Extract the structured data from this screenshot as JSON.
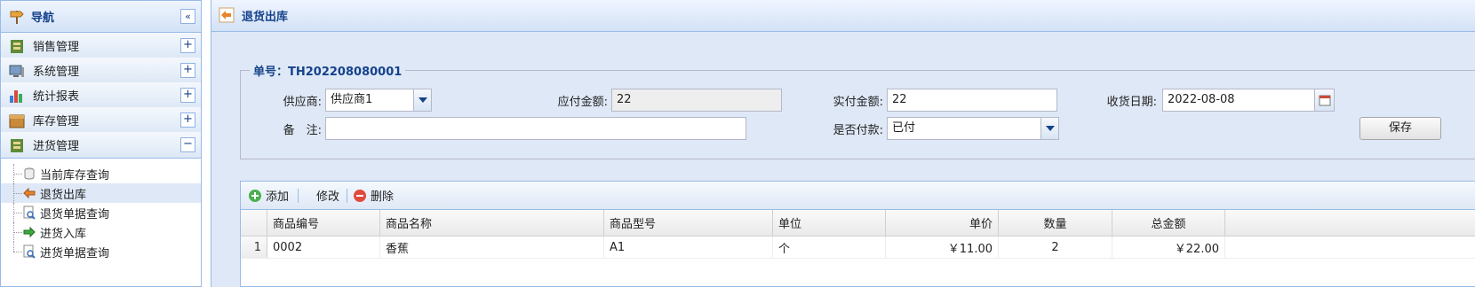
{
  "colors": {
    "accent": "#15428b",
    "panel_border": "#99bbe8",
    "background": "#dfe8f6"
  },
  "nav": {
    "title": "导航",
    "collapse_glyph": "«",
    "sections": [
      {
        "label": "销售管理",
        "icon": "sales-icon",
        "toggle": "+"
      },
      {
        "label": "系统管理",
        "icon": "computer-icon",
        "toggle": "+"
      },
      {
        "label": "统计报表",
        "icon": "bar-chart-icon",
        "toggle": "+"
      },
      {
        "label": "库存管理",
        "icon": "box-icon",
        "toggle": "+"
      },
      {
        "label": "进货管理",
        "icon": "purchase-icon",
        "toggle": "−"
      }
    ],
    "items": [
      {
        "label": "当前库存查询",
        "icon": "database-icon",
        "selected": false
      },
      {
        "label": "退货出库",
        "icon": "return-arrow-icon",
        "selected": true
      },
      {
        "label": "退货单据查询",
        "icon": "search-document-icon",
        "selected": false
      },
      {
        "label": "进货入库",
        "icon": "inbound-arrow-icon",
        "selected": false
      },
      {
        "label": "进货单据查询",
        "icon": "search-document-icon",
        "selected": false
      }
    ]
  },
  "panel": {
    "title": "退货出库",
    "icon": "return-arrow-icon"
  },
  "form": {
    "legend": "单号：TH202208080001",
    "supplier_label": "供应商:",
    "supplier_value": "供应商1",
    "payable_label": "应付金额:",
    "payable_value": "22",
    "paid_label": "实付金额:",
    "paid_value": "22",
    "date_label": "收货日期:",
    "date_value": "2022-08-08",
    "remark_label": "备　注:",
    "remark_value": "",
    "is_paid_label": "是否付款:",
    "is_paid_value": "已付",
    "save_label": "保存"
  },
  "toolbar": {
    "add_label": "添加",
    "edit_label": "修改",
    "delete_label": "删除"
  },
  "grid": {
    "columns": [
      "商品编号",
      "商品名称",
      "商品型号",
      "单位",
      "单价",
      "数量",
      "总金额"
    ],
    "rows": [
      {
        "no": "1",
        "code": "0002",
        "name": "香蕉",
        "model": "A1",
        "unit": "个",
        "price": "￥11.00",
        "qty": "2",
        "total": "￥22.00"
      }
    ]
  }
}
